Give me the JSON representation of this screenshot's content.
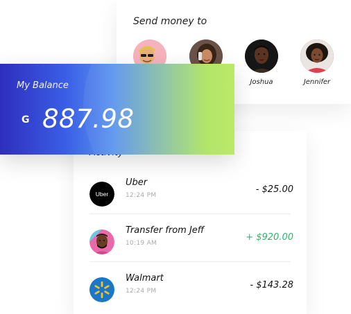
{
  "send_money": {
    "title": "Send money to",
    "contacts": [
      {
        "name": "",
        "icon": "avatar-sunglasses-man",
        "bg": "#f7a7b3"
      },
      {
        "name": "",
        "icon": "avatar-phone-woman",
        "bg": "#5a4038"
      },
      {
        "name": "Joshua",
        "icon": "avatar-joshua",
        "bg": "#1c1c1c"
      },
      {
        "name": "Jennifer",
        "icon": "avatar-jennifer",
        "bg": "#d23a4a"
      }
    ]
  },
  "balance": {
    "label": "My Balance",
    "currency": "G",
    "amount": "887.98"
  },
  "activity": {
    "title": "Activity",
    "transactions": [
      {
        "name": "Uber",
        "time": "12:24 PM",
        "amount": "- $25.00",
        "icon": "uber-logo",
        "icon_text": "Uber"
      },
      {
        "name": "Transfer from Jeff",
        "time": "10:19 AM",
        "amount": "+ $920.00",
        "icon": "avatar-jeff"
      },
      {
        "name": "Walmart",
        "time": "12:24 PM",
        "amount": "- $143.28",
        "icon": "walmart-logo"
      }
    ]
  },
  "colors": {
    "positive": "#2fb46a",
    "gradient_start": "#2f2ebd",
    "gradient_end": "#b8e85e"
  }
}
